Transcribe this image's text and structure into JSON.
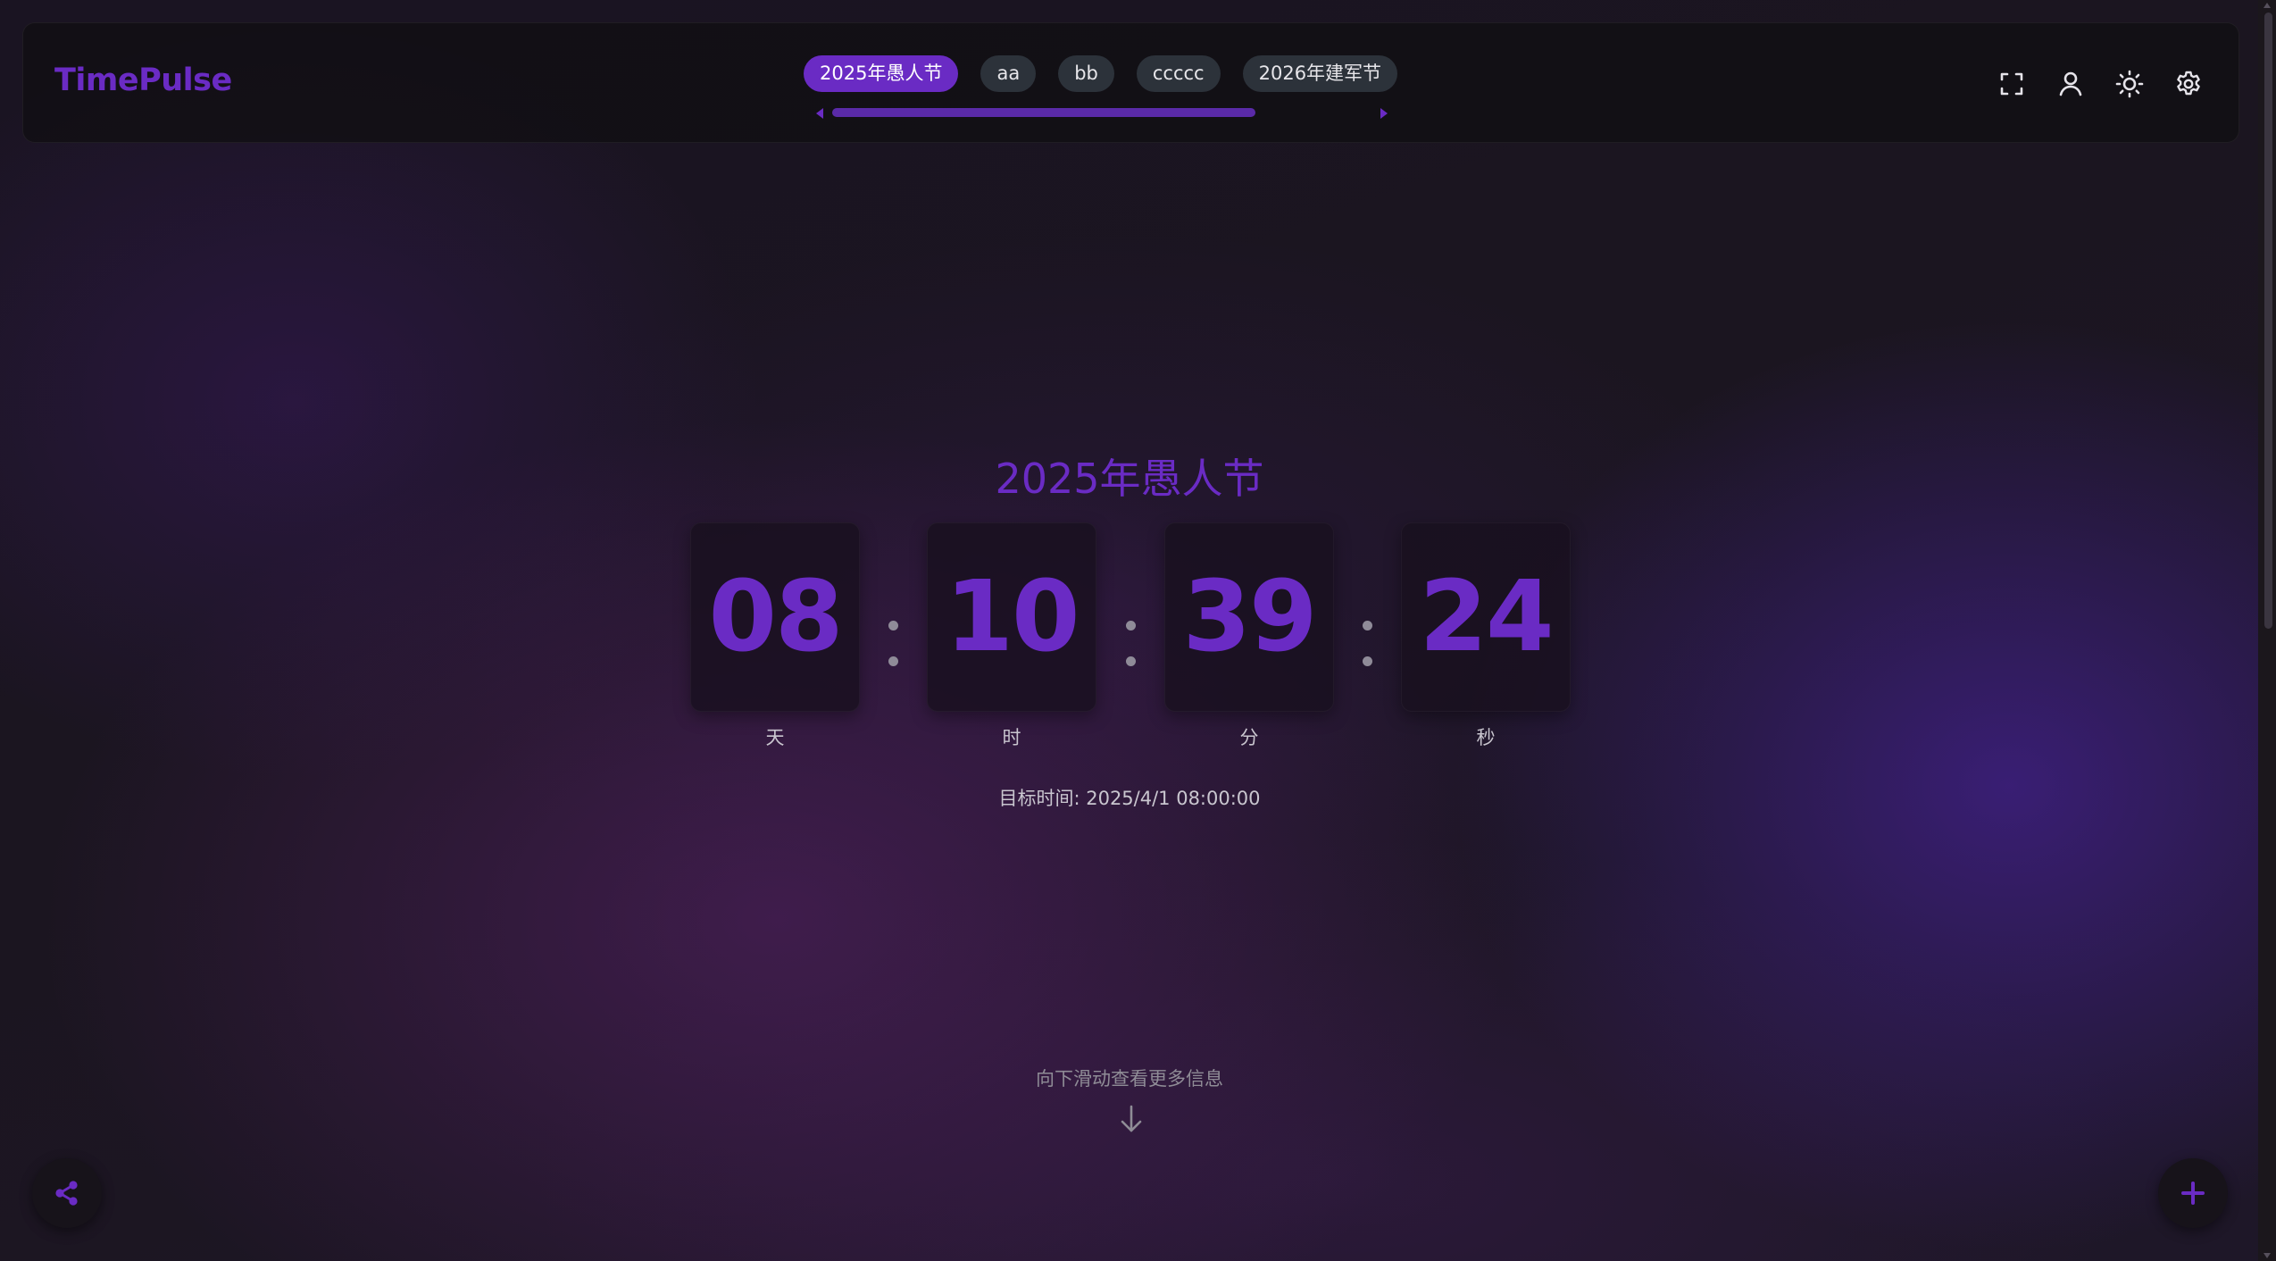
{
  "app": {
    "logo": "TimePulse"
  },
  "tabs": [
    {
      "label": "2025年愚人节",
      "active": true
    },
    {
      "label": "aa",
      "active": false
    },
    {
      "label": "bb",
      "active": false
    },
    {
      "label": "ccccc",
      "active": false
    },
    {
      "label": "2026年建军节",
      "active": false
    }
  ],
  "header_icons": [
    "fullscreen-icon",
    "user-icon",
    "sun-icon",
    "settings-icon"
  ],
  "countdown": {
    "title": "2025年愚人节",
    "units": [
      {
        "value": "08",
        "label": "天"
      },
      {
        "value": "10",
        "label": "时"
      },
      {
        "value": "39",
        "label": "分"
      },
      {
        "value": "24",
        "label": "秒"
      }
    ],
    "target_time": "目标时间: 2025/4/1 08:00:00"
  },
  "scroll_hint": "向下滑动查看更多信息",
  "fab": {
    "left_icon": "share-icon",
    "right_icon": "plus-icon"
  },
  "colors": {
    "accent": "#6a2bc4",
    "header_bg": "#110f14",
    "tab_bg": "#2c323a",
    "text_muted": "#c9c6cf"
  }
}
